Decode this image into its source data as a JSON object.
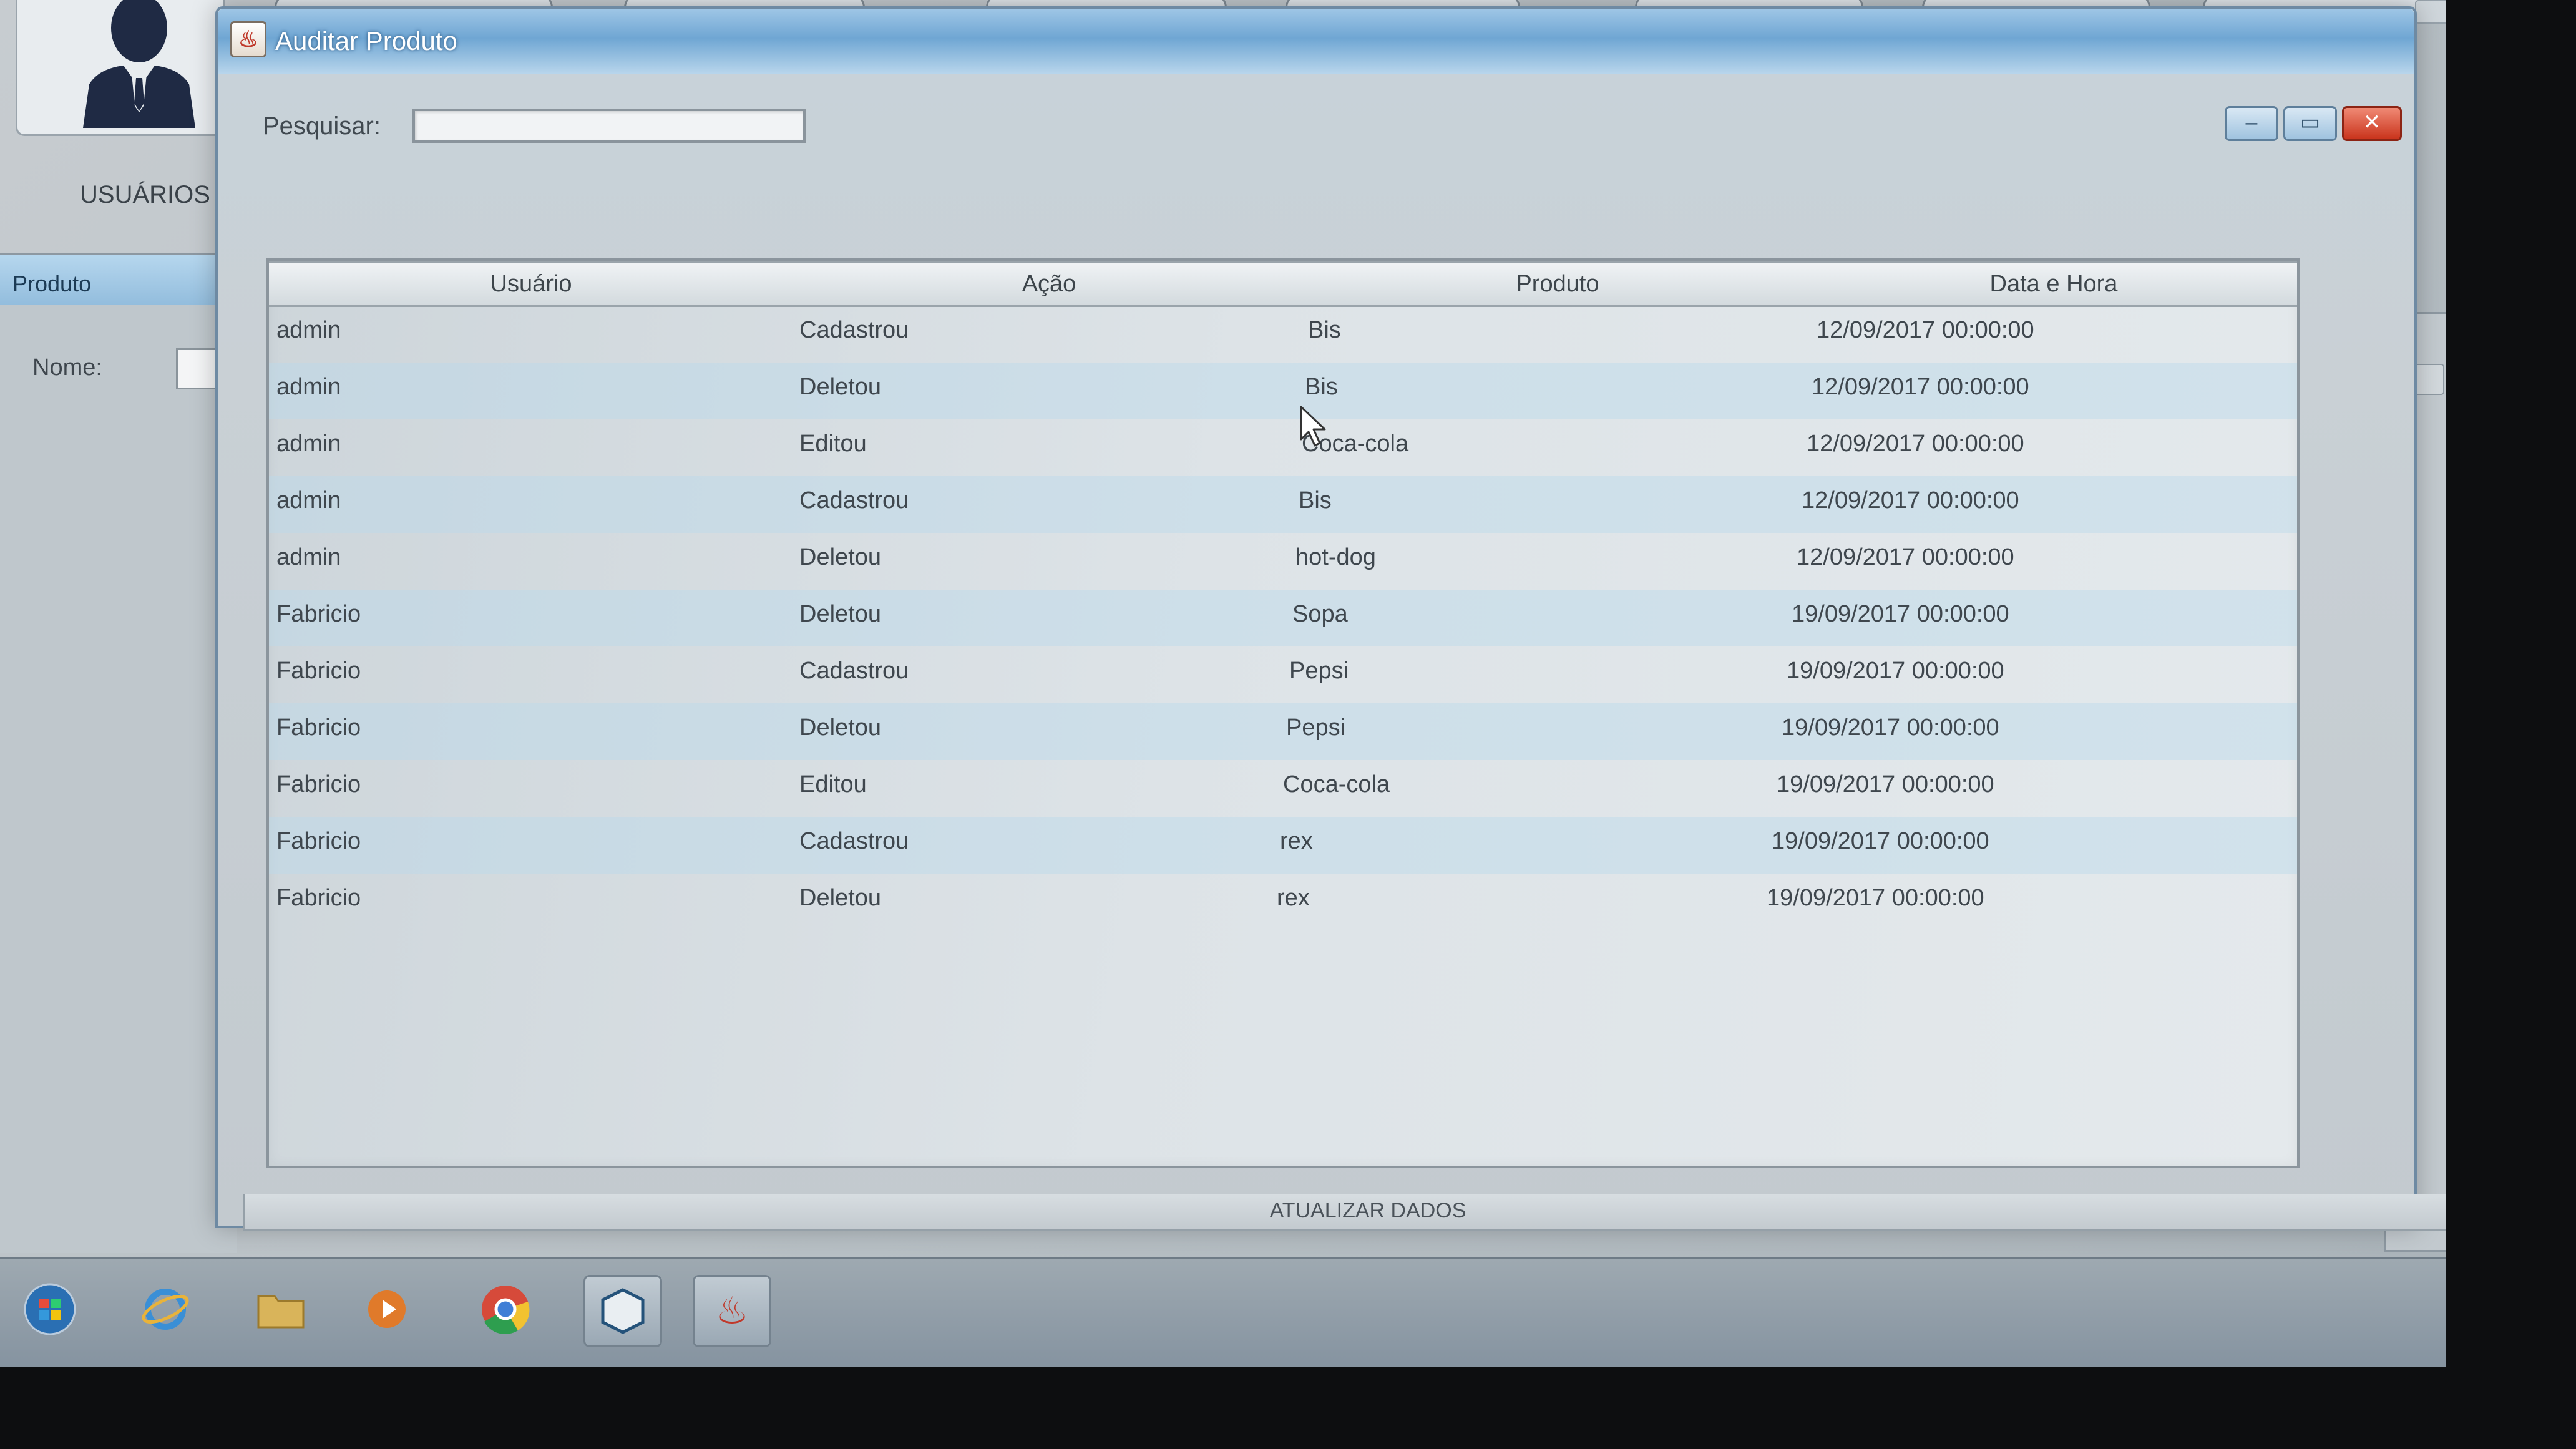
{
  "background_app": {
    "usuarios_label": "USUÁRIOS",
    "produto_frame_title": "Produto",
    "nome_label": "Nome:"
  },
  "dialog": {
    "title": "Auditar Produto",
    "search": {
      "label": "Pesquisar:",
      "value": "",
      "placeholder": ""
    },
    "table": {
      "columns": [
        "Usuário",
        "Ação",
        "Produto",
        "Data e Hora"
      ],
      "rows": [
        {
          "usuario": "admin",
          "acao": "Cadastrou",
          "produto": "Bis",
          "data_hora": "12/09/2017 00:00:00"
        },
        {
          "usuario": "admin",
          "acao": "Deletou",
          "produto": "Bis",
          "data_hora": "12/09/2017 00:00:00"
        },
        {
          "usuario": "admin",
          "acao": "Editou",
          "produto": "Coca-cola",
          "data_hora": "12/09/2017 00:00:00"
        },
        {
          "usuario": "admin",
          "acao": "Cadastrou",
          "produto": "Bis",
          "data_hora": "12/09/2017 00:00:00"
        },
        {
          "usuario": "admin",
          "acao": "Deletou",
          "produto": "hot-dog",
          "data_hora": "12/09/2017 00:00:00"
        },
        {
          "usuario": "Fabricio",
          "acao": "Deletou",
          "produto": "Sopa",
          "data_hora": "19/09/2017 00:00:00"
        },
        {
          "usuario": "Fabricio",
          "acao": "Cadastrou",
          "produto": "Pepsi",
          "data_hora": "19/09/2017 00:00:00"
        },
        {
          "usuario": "Fabricio",
          "acao": "Deletou",
          "produto": "Pepsi",
          "data_hora": "19/09/2017 00:00:00"
        },
        {
          "usuario": "Fabricio",
          "acao": "Editou",
          "produto": "Coca-cola",
          "data_hora": "19/09/2017 00:00:00"
        },
        {
          "usuario": "Fabricio",
          "acao": "Cadastrou",
          "produto": "rex",
          "data_hora": "19/09/2017 00:00:00"
        },
        {
          "usuario": "Fabricio",
          "acao": "Deletou",
          "produto": "rex",
          "data_hora": "19/09/2017 00:00:00"
        }
      ]
    },
    "refresh_button_label": "ATUALIZAR DADOS"
  },
  "taskbar": {
    "items": [
      "start-orb-icon",
      "internet-explorer-icon",
      "folder-icon",
      "media-player-icon",
      "chrome-icon",
      "virtualbox-icon",
      "java-app-icon"
    ]
  },
  "colors": {
    "title_bar": "#6fa6d3",
    "close_button": "#c9331b",
    "row_highlight": "#bad9ec"
  }
}
